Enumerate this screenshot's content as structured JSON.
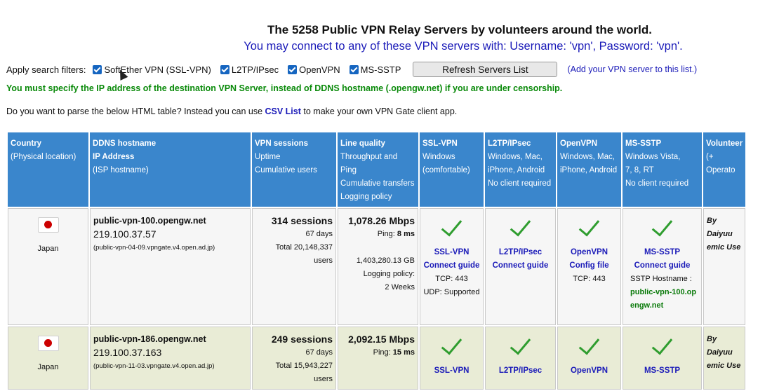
{
  "header": {
    "title": "The 5258 Public VPN Relay Servers by volunteers around the world.",
    "subtitle": "You may connect to any of these VPN servers with: Username: 'vpn', Password: 'vpn'."
  },
  "filters": {
    "label": "Apply search filters:",
    "options": [
      {
        "label": "SoftEther VPN (SSL-VPN)",
        "checked": true
      },
      {
        "label": "L2TP/IPsec",
        "checked": true
      },
      {
        "label": "OpenVPN",
        "checked": true
      },
      {
        "label": "MS-SSTP",
        "checked": true
      }
    ],
    "refresh_label": "Refresh Servers List",
    "add_link": "(Add your VPN server to this list.)"
  },
  "warning": "You must specify the IP address of the destination VPN Server, instead of DDNS hostname (.opengw.net) if you are under censorship.",
  "parse_prompt": {
    "before": "Do you want to parse the below HTML table? Instead you can use ",
    "link": "CSV List",
    "after": " to make your own VPN Gate client app."
  },
  "table": {
    "columns": [
      {
        "title": "Country",
        "lines": [
          "(Physical location)"
        ]
      },
      {
        "title": "DDNS hostname",
        "lines": [
          "IP Address",
          "(ISP hostname)"
        ]
      },
      {
        "title": "VPN sessions",
        "lines": [
          "Uptime",
          "Cumulative users"
        ]
      },
      {
        "title": "Line quality",
        "lines": [
          "Throughput and Ping",
          "Cumulative transfers",
          "Logging policy"
        ]
      },
      {
        "title": "SSL-VPN",
        "lines": [
          "Windows",
          "(comfortable)"
        ]
      },
      {
        "title": "L2TP/IPsec",
        "lines": [
          "Windows, Mac,",
          "iPhone, Android",
          "No client required"
        ]
      },
      {
        "title": "OpenVPN",
        "lines": [
          "Windows, Mac,",
          "iPhone, Android"
        ]
      },
      {
        "title": "MS-SSTP",
        "lines": [
          "Windows Vista,",
          "7, 8, RT",
          "No client required"
        ]
      },
      {
        "title": "Volunteer",
        "lines": [
          "(+ Operato"
        ]
      }
    ],
    "rows": [
      {
        "country": "Japan",
        "hostname": "public-vpn-100.opengw.net",
        "ip": "219.100.37.57",
        "isp": "(public-vpn-04-09.vpngate.v4.open.ad.jp)",
        "sessions": "314 sessions",
        "uptime": "67 days",
        "users": "Total 20,148,337 users",
        "speed": "1,078.26 Mbps",
        "ping_label": "Ping: ",
        "ping": "8 ms",
        "transfer": "1,403,280.13 GB",
        "logging_label": "Logging policy:",
        "logging": "2 Weeks",
        "ssl_lines": [
          "SSL-VPN",
          "Connect guide"
        ],
        "ssl_tcp": "TCP: 443",
        "ssl_udp": "UDP: Supported",
        "l2tp_lines": [
          "L2TP/IPsec",
          "Connect guide"
        ],
        "ovpn_lines": [
          "OpenVPN",
          "Config file"
        ],
        "ovpn_tcp": "TCP: 443",
        "sstp_lines": [
          "MS-SSTP",
          "Connect guide"
        ],
        "sstp_host_label": "SSTP Hostname :",
        "sstp_host_1": "public-vpn-100.op",
        "sstp_host_2": "engw.net",
        "volunteer_1": "By Daiyuu",
        "volunteer_2": "emic Use"
      },
      {
        "country": "Japan",
        "hostname": "public-vpn-186.opengw.net",
        "ip": "219.100.37.163",
        "isp": "(public-vpn-11-03.vpngate.v4.open.ad.jp)",
        "sessions": "249 sessions",
        "uptime": "67 days",
        "users": "Total 15,943,227 users",
        "speed": "2,092.15 Mbps",
        "ping_label": "Ping: ",
        "ping": "15 ms",
        "ssl_label": "SSL-VPN",
        "l2tp_label": "L2TP/IPsec",
        "ovpn_label": "OpenVPN",
        "sstp_label": "MS-SSTP",
        "volunteer_1": "By Daiyuu",
        "volunteer_2": "emic Use"
      }
    ]
  }
}
